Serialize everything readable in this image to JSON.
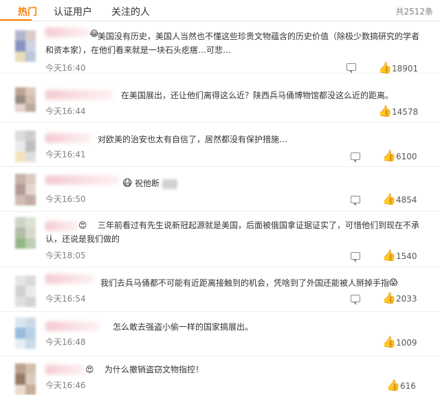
{
  "tabs": {
    "hot": "热门",
    "verified": "认证用户",
    "followed": "关注的人"
  },
  "total": "共2512条",
  "comments": [
    {
      "text": "美国没有历史，美国人当然也不懂这些珍贵文物蕴含的历史价值（除极少数搞研究的学者和资本家），在他们看来就是一块石头疙瘩…可悲…",
      "time": "今天16:40",
      "likes": "18901"
    },
    {
      "text": "在美国展出，还让他们离得这么近？陕西兵马俑博物馆都没这么近的距离。",
      "time": "今天16:44",
      "likes": "14578"
    },
    {
      "text": "对欧美的治安也太有自信了，居然都没有保护措施…",
      "time": "今天16:41",
      "likes": "6100"
    },
    {
      "text": "祝他断",
      "time": "今天16:50",
      "likes": "4854"
    },
    {
      "text": "三年前看过有先生说新冠起源就是美国，后面被俄国拿证据证实了，可惜他们到现在不承认，还说是我们做的",
      "time": "今天18:05",
      "likes": "1540"
    },
    {
      "text": "我们去兵马俑都不可能有近距离接触到的机会，凭啥到了外国还能被人掰掉手指",
      "time": "今天16:54",
      "likes": "2033"
    },
    {
      "text": "怎么敢去强盗小偷一样的国家搞展出。",
      "time": "今天16:48",
      "likes": "1009"
    },
    {
      "text": "为什么撤销盗窃文物指控！",
      "time": "今天16:46",
      "likes": "616"
    }
  ],
  "icons": {
    "reply": "comment-icon",
    "like": "thumbs-up-icon"
  },
  "colors": {
    "accent": "#ff8200",
    "time": "#808080",
    "divider": "#eeeeee"
  }
}
